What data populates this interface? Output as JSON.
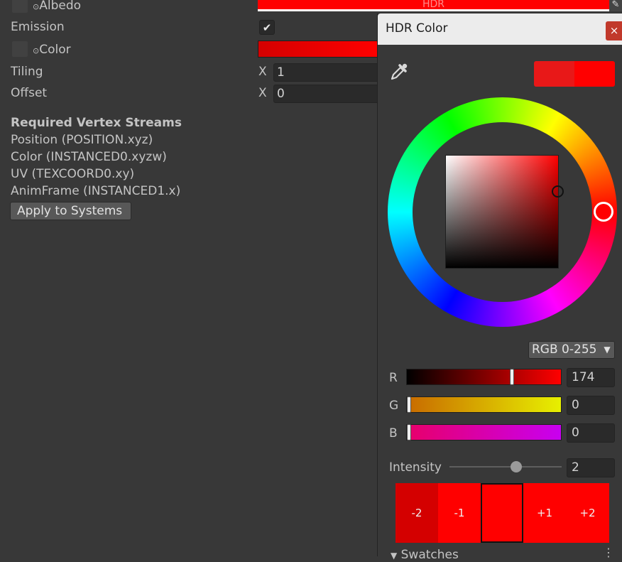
{
  "inspector": {
    "albedo_label": "Albedo",
    "albedo_hdr": "HDR",
    "emission_label": "Emission",
    "color_label": "Color",
    "tiling_label": "Tiling",
    "tiling_axis": "X",
    "tiling_x": "1",
    "offset_label": "Offset",
    "offset_axis": "X",
    "offset_x": "0",
    "streams_title": "Required Vertex Streams",
    "streams": [
      "Position (POSITION.xyz)",
      "Color (INSTANCED0.xyzw)",
      "UV (TEXCOORD0.xy)",
      "AnimFrame (INSTANCED1.x)"
    ],
    "apply_button": "Apply to Systems",
    "emission_checked": true
  },
  "popup": {
    "title": "HDR Color",
    "close": "×",
    "mode": "RGB 0-255",
    "channels": [
      {
        "label": "R",
        "value": "174",
        "fraction": 0.68
      },
      {
        "label": "G",
        "value": "0",
        "fraction": 0.0
      },
      {
        "label": "B",
        "value": "0",
        "fraction": 0.0
      }
    ],
    "intensity_label": "Intensity",
    "intensity_value": "2",
    "swatches": [
      "-2",
      "-1",
      "",
      "+1",
      "+2"
    ],
    "swatches_label": "Swatches"
  },
  "colors": {
    "accent_red": "#ff0000",
    "dark_red": "#d40000"
  }
}
